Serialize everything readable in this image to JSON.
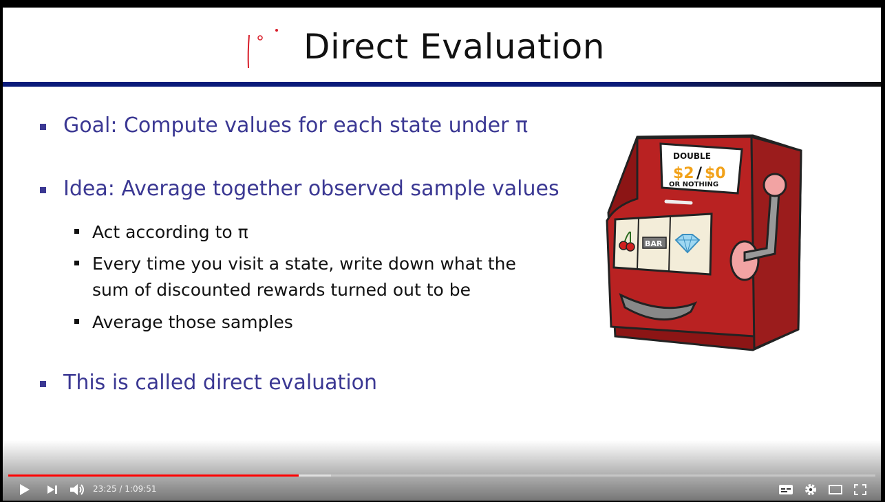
{
  "slide": {
    "title": "Direct Evaluation",
    "bullets": [
      {
        "text": "Goal: Compute values for each state under π"
      },
      {
        "text": "Idea: Average together observed sample values",
        "sub": [
          "Act according to π",
          "Every time you visit a state, write down what the",
          "sum of discounted rewards turned out to be",
          "Average those samples"
        ]
      },
      {
        "text": "This is called direct evaluation"
      }
    ],
    "sign": {
      "line1": "DOUBLE",
      "prize1": "$2",
      "slash": "/",
      "prize2": "$0",
      "line3": "OR NOTHING"
    },
    "reel_bar": "BAR"
  },
  "player": {
    "current_time": "23:25",
    "separator": " / ",
    "duration": "1:09:51",
    "played_fraction": 0.335,
    "buffered_fraction": 0.372,
    "colors": {
      "progress": "#ff0000",
      "title_rule": "#0a1b7a",
      "bullet_text": "#3b3893"
    }
  }
}
